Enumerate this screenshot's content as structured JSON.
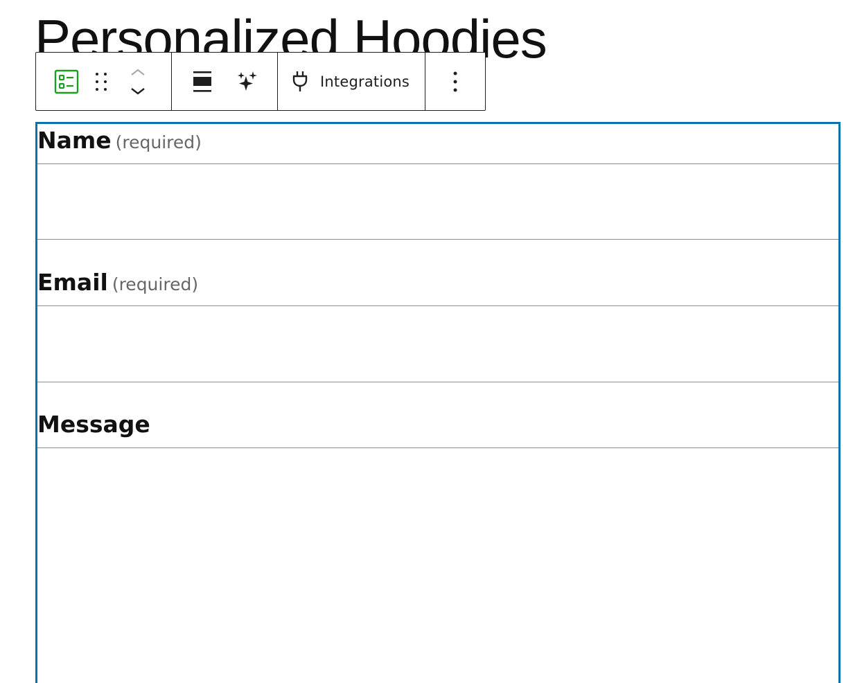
{
  "page": {
    "title": "Personalized Hoodies"
  },
  "toolbar": {
    "icons": {
      "block": "form-block-icon",
      "drag": "drag-handle-icon",
      "move_up": "chevron-up-icon",
      "move_down": "chevron-down-icon",
      "align": "align-full-width-icon",
      "ai": "sparkle-icon",
      "integrations": "plug-icon",
      "more": "more-vertical-icon"
    },
    "integrations_label": "Integrations",
    "accent_color": "#1a9e1f"
  },
  "form": {
    "border_color": "#0a73aa",
    "fields": [
      {
        "label": "Name",
        "required_text": "(required)",
        "value": ""
      },
      {
        "label": "Email",
        "required_text": "(required)",
        "value": ""
      },
      {
        "label": "Message",
        "required_text": "",
        "value": ""
      }
    ]
  }
}
